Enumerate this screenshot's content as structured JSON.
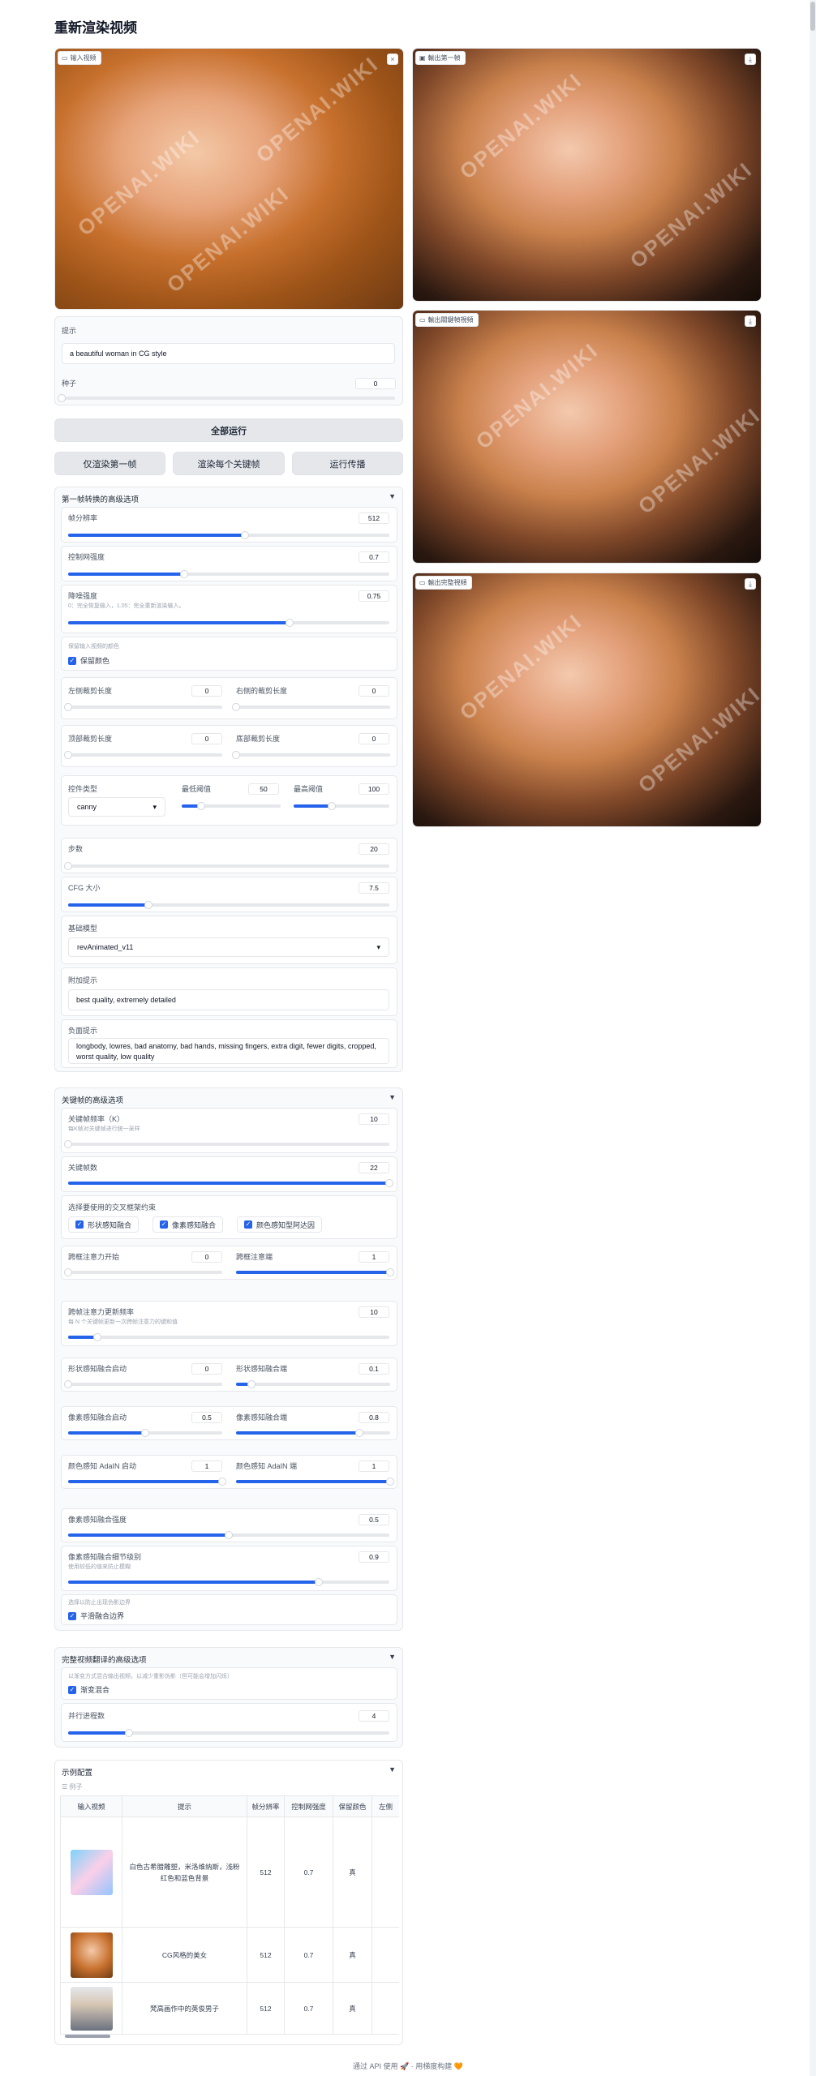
{
  "page": {
    "title": "重新渲染视频"
  },
  "videos": {
    "input": {
      "label": "输入视频",
      "close": "×"
    },
    "first_frame": {
      "label": "輸出第一幀",
      "action": "⤓"
    },
    "keyframes": {
      "label": "輸出關鍵幀視頻",
      "action": "⤓"
    },
    "full": {
      "label": "輸出完整視頻",
      "action": "⤓"
    },
    "watermark": "OPENAI.WIKI"
  },
  "prompt": {
    "label": "提示",
    "value": "a beautiful woman in CG style"
  },
  "seed": {
    "label": "种子",
    "value": "0",
    "level": 0
  },
  "buttons": {
    "run_all": "全部运行",
    "first_only": "仅渲染第一帧",
    "each_key": "渲染每个关键帧",
    "run_prop": "运行传播"
  },
  "first_frame_section": {
    "title": "第一帧转换的高级选项",
    "arrow": "▼",
    "resolution": {
      "label": "帧分辨率",
      "value": "512",
      "level": 0.55
    },
    "control_strength": {
      "label": "控制网强度",
      "value": "0.7",
      "level": 0.36
    },
    "denoise": {
      "label": "降噪强度",
      "sub": "0：完全恢复输入，1.05：完全重新渲染输入。",
      "value": "0.75",
      "level": 0.69
    },
    "preserve_color_hint": "保留输入视频的颜色",
    "preserve_color": "保留颜色",
    "crop_left": {
      "label": "左侧裁剪长度",
      "value": "0"
    },
    "crop_right": {
      "label": "右侧的裁剪长度",
      "value": "0"
    },
    "crop_top": {
      "label": "顶部裁剪长度",
      "value": "0"
    },
    "crop_bottom": {
      "label": "底部裁剪长度",
      "value": "0"
    },
    "control_type": {
      "label": "控件类型",
      "value": "canny",
      "caret": "▾"
    },
    "low_thresh": {
      "label": "最低阈值",
      "value": "50",
      "level": 0.2
    },
    "high_thresh": {
      "label": "最高阈值",
      "value": "100",
      "level": 0.4
    },
    "steps": {
      "label": "步数",
      "value": "20",
      "level": 0.0
    },
    "cfg": {
      "label": "CFG 大小",
      "value": "7.5",
      "level": 0.25
    },
    "base_model": {
      "label": "基础模型",
      "value": "revAnimated_v11",
      "caret": "▾"
    },
    "added_prompt": {
      "label": "附加提示",
      "value": "best quality, extremely detailed"
    },
    "negative_prompt": {
      "label": "负面提示",
      "value": "longbody, lowres, bad anatomy, bad hands, missing fingers, extra digit, fewer digits, cropped, worst quality, low quality"
    }
  },
  "keyframe_section": {
    "title": "关键帧的高级选项",
    "arrow": "▼",
    "interval": {
      "label": "关键帧频率（K）",
      "sub": "每K帧对关键帧进行统一采样",
      "value": "10",
      "level": 0.0
    },
    "num_keyframes": {
      "label": "关键帧数",
      "value": "22",
      "level": 1.0
    },
    "constraints_label": "选择要使用的交叉框架约束",
    "constraints": [
      "形状感知融合",
      "像素感知融合",
      "颜色感知型阿达因"
    ],
    "attn_start": {
      "label": "跨框注意力开始",
      "value": "0",
      "level": 0.0
    },
    "attn_end": {
      "label": "跨框注意端",
      "value": "1",
      "level": 1.0
    },
    "attn_update": {
      "label": "跨帧注意力更新频率",
      "sub": "每 N 个关键帧更新一次跨帧注意力的键和值",
      "value": "10",
      "level": 0.09
    },
    "shape_start": {
      "label": "形状感知融合启动",
      "value": "0",
      "level": 0.0
    },
    "shape_end": {
      "label": "形状感知融合端",
      "value": "0.1",
      "level": 0.1
    },
    "pixel_start": {
      "label": "像素感知融合启动",
      "value": "0.5",
      "level": 0.5
    },
    "pixel_end": {
      "label": "像素感知融合端",
      "value": "0.8",
      "level": 0.8
    },
    "color_start": {
      "label": "颜色感知 AdaIN 启动",
      "value": "1",
      "level": 1.0
    },
    "color_end": {
      "label": "颜色感知 AdaIN 端",
      "value": "1",
      "level": 1.0
    },
    "pixel_strength": {
      "label": "像素感知融合强度",
      "value": "0.5",
      "level": 0.5
    },
    "pixel_detail": {
      "label": "像素感知融合细节级别",
      "sub": "使用较低的值来防止模糊",
      "value": "0.9",
      "level": 0.78
    },
    "smooth_hint": "选择以防止出现伪影边界",
    "smooth": "平滑融合边界"
  },
  "full_section": {
    "title": "完整视频翻译的高级选项",
    "arrow": "▼",
    "hint": "以渐变方式混合输出视频，以减少重影伪影（但可能会增加闪烁）",
    "gradient": "渐变混合",
    "parallel": {
      "label": "并行进程数",
      "value": "4",
      "level": 0.19
    }
  },
  "examples": {
    "title": "示例配置",
    "arrow": "▼",
    "count": "☰ 例子",
    "columns": [
      "输入视频",
      "提示",
      "帧分辨率",
      "控制网强度",
      "保留颜色",
      "左侧"
    ],
    "rows": [
      {
        "prompt": "白色古希腊雕塑，米洛维纳斯，浅粉红色和蓝色背景",
        "res": "512",
        "ctrl": "0.7",
        "keep": "真"
      },
      {
        "prompt": "CG风格的美女",
        "res": "512",
        "ctrl": "0.7",
        "keep": "真"
      },
      {
        "prompt": "梵高画作中的英俊男子",
        "res": "512",
        "ctrl": "0.7",
        "keep": "真"
      }
    ]
  },
  "footer": "通过 API 使用 🚀  ·  用梯度构建 🧡"
}
